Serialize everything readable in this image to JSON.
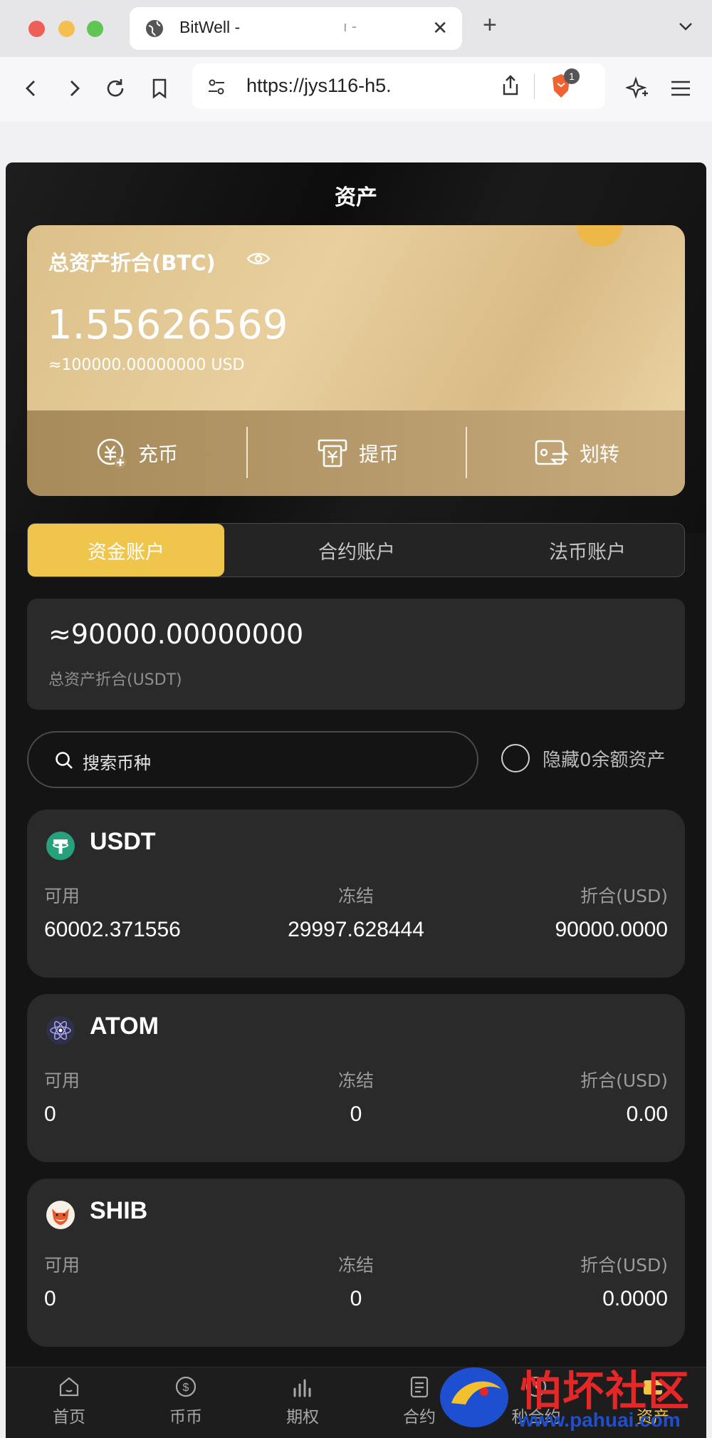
{
  "browser": {
    "tab_title": "BitWell -",
    "tab_title_extra": "ı -",
    "url": "https://jys116-h5.",
    "brave_badge": "1",
    "colors": {
      "close": "#ee5f57",
      "minimize": "#f5bf4f",
      "maximize": "#61c554"
    }
  },
  "app": {
    "page_title": "资产",
    "balance": {
      "label": "总资产折合(BTC)",
      "btc": "1.55626569",
      "usd": "≈100000.00000000 USD"
    },
    "actions": [
      {
        "label": "充币",
        "icon": "deposit-icon"
      },
      {
        "label": "提币",
        "icon": "withdraw-icon"
      },
      {
        "label": "划转",
        "icon": "transfer-icon"
      }
    ],
    "account_tabs": [
      "资金账户",
      "合约账户",
      "法币账户"
    ],
    "active_account_tab": "资金账户",
    "usdt_total": {
      "value": "≈90000.00000000",
      "label": "总资产折合(USDT)"
    },
    "search": {
      "placeholder": "搜索币种"
    },
    "hide_zero_label": "隐藏0余额资产",
    "assets": [
      {
        "symbol": "USDT",
        "icon": "usdt-icon",
        "available_label": "可用",
        "frozen_label": "冻结",
        "value_label": "折合(USD)",
        "available": "60002.371556",
        "frozen": "29997.628444",
        "value": "90000.0000"
      },
      {
        "symbol": "ATOM",
        "icon": "atom-icon",
        "available_label": "可用",
        "frozen_label": "冻结",
        "value_label": "折合(USD)",
        "available": "0",
        "frozen": "0",
        "value": "0.00"
      },
      {
        "symbol": "SHIB",
        "icon": "shib-icon",
        "available_label": "可用",
        "frozen_label": "冻结",
        "value_label": "折合(USD)",
        "available": "0",
        "frozen": "0",
        "value": "0.0000"
      }
    ],
    "bottom_nav": [
      {
        "label": "首页",
        "icon": "home-icon"
      },
      {
        "label": "币币",
        "icon": "coin-icon"
      },
      {
        "label": "期权",
        "icon": "chart-bars-icon"
      },
      {
        "label": "合约",
        "icon": "contract-icon"
      },
      {
        "label": "秒合约",
        "icon": "clock-icon"
      },
      {
        "label": "资产",
        "icon": "wallet-icon"
      }
    ],
    "colors": {
      "accent": "#efc64b",
      "card": "#2a2a2a",
      "background": "#141414"
    }
  },
  "watermark": {
    "text": "怕坏社区",
    "url": "www.pahuai.com"
  }
}
